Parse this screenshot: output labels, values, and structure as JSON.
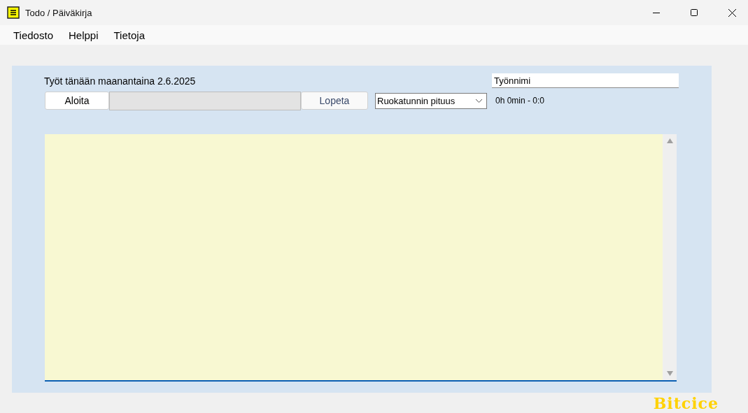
{
  "window": {
    "title": "Todo / Päiväkirja"
  },
  "menu": [
    "Tiedosto",
    "Helppi",
    "Tietoja"
  ],
  "heading": "Työt tänään maanantaina 2.6.2025",
  "start_button": "Aloita",
  "progress": {
    "level": 0
  },
  "stop_button": {
    "label": "Lopeta",
    "disabled": true
  },
  "lunch_select": {
    "value": "Ruokatunnin pituus"
  },
  "task_name": {
    "value": "Työnnimi"
  },
  "duration": "0h 0min - 0:0",
  "brand": "Bitcice"
}
